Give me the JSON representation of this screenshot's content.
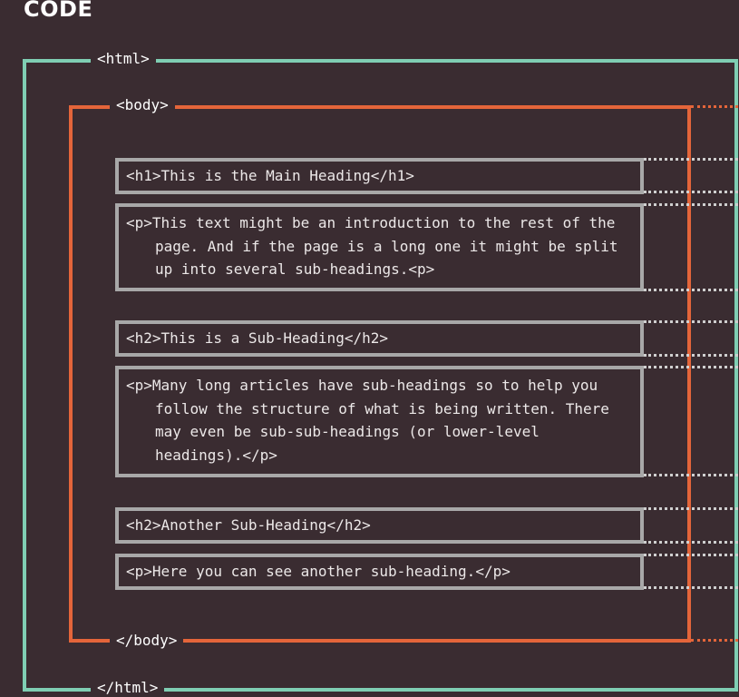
{
  "title": "CODE",
  "html_tags": {
    "open": "<html>",
    "close": "</html>"
  },
  "body_tags": {
    "open": "<body>",
    "close": "</body>"
  },
  "elements": [
    {
      "code": "<h1>This is the Main Heading</h1>"
    },
    {
      "code": "<p>This text might be an introduction to the rest of the page. And if the page is a long one it might be split up into several sub-headings.<p>"
    },
    {
      "code": "<h2>This is a Sub-Heading</h2>"
    },
    {
      "code": "<p>Many long articles have sub-headings so to help you follow the structure of what is being written. There may even be sub-sub-headings (or lower-level headings).</p>"
    },
    {
      "code": "<h2>Another Sub-Heading</h2>"
    },
    {
      "code": "<p>Here you can see another sub-heading.</p>"
    }
  ],
  "colors": {
    "background": "#3a2c31",
    "html_border": "#7fceb3",
    "body_border": "#e4653a",
    "element_border": "#a8a8a8",
    "text": "#ece8e8"
  }
}
